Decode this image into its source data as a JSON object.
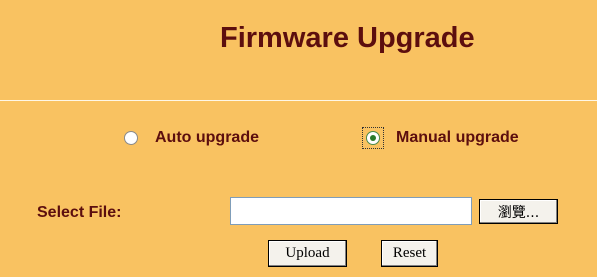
{
  "page": {
    "title": "Firmware Upgrade"
  },
  "upgrade_mode": {
    "options": [
      {
        "label": "Auto upgrade",
        "selected": false
      },
      {
        "label": "Manual upgrade",
        "selected": true
      }
    ]
  },
  "file_select": {
    "label": "Select File:",
    "value": "",
    "browse_label": "瀏覽..."
  },
  "actions": {
    "upload_label": "Upload",
    "reset_label": "Reset"
  },
  "colors": {
    "background": "#F9C261",
    "text": "#5C0E0E",
    "divider": "#FFF7E6"
  }
}
